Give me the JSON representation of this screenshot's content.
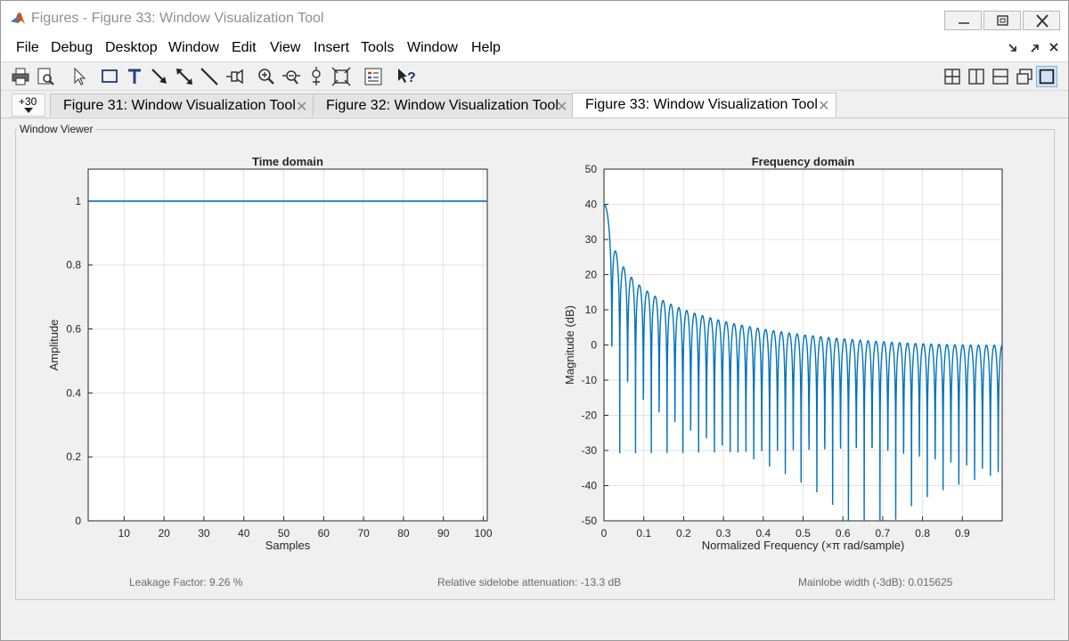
{
  "window": {
    "title": "Figures - Figure 33: Window Visualization Tool"
  },
  "menubar": {
    "items": [
      "File",
      "Debug",
      "Desktop",
      "Window",
      "Edit",
      "View",
      "Insert",
      "Tools",
      "Window",
      "Help"
    ]
  },
  "toolbar": {
    "tools": [
      "print-icon",
      "print-preview-icon",
      "pointer-icon",
      "rectangle-icon",
      "text-icon",
      "arrow-icon",
      "double-arrow-icon",
      "line-icon",
      "pin-icon",
      "zoom-in-icon",
      "zoom-out-icon",
      "pan-icon",
      "fit-icon",
      "legend-icon",
      "whats-this-icon"
    ],
    "layout": [
      "tile-icon",
      "left-right-icon",
      "top-bottom-icon",
      "float-icon",
      "maximize-icon"
    ]
  },
  "tabs": {
    "overflow_label": "+30",
    "items": [
      {
        "label": "Figure 31: Window Visualization Tool",
        "active": false
      },
      {
        "label": "Figure 32: Window Visualization Tool",
        "active": false
      },
      {
        "label": "Figure 33: Window Visualization Tool",
        "active": true
      }
    ]
  },
  "viewer": {
    "group_title": "Window Viewer"
  },
  "chart_data": [
    {
      "type": "line",
      "title": "Time domain",
      "xlabel": "Samples",
      "ylabel": "Amplitude",
      "xlim": [
        1,
        101
      ],
      "ylim": [
        0,
        1.1
      ],
      "xticks": [
        "10",
        "20",
        "30",
        "40",
        "50",
        "60",
        "70",
        "80",
        "90",
        "100"
      ],
      "yticks": [
        "0",
        "0.2",
        "0.4",
        "0.6",
        "0.8",
        "1"
      ],
      "grid": true,
      "series": [
        {
          "x": [
            1,
            101
          ],
          "y": [
            1,
            1
          ]
        }
      ],
      "color": "#0072bd"
    },
    {
      "type": "line",
      "title": "Frequency domain",
      "xlabel": "Normalized Frequency  (×π rad/sample)",
      "ylabel": "Magnitude (dB)",
      "xlim": [
        0,
        1
      ],
      "ylim": [
        -50,
        50
      ],
      "xticks": [
        "0",
        "0.1",
        "0.2",
        "0.3",
        "0.4",
        "0.5",
        "0.6",
        "0.7",
        "0.8",
        "0.9"
      ],
      "yticks": [
        "-50",
        "-40",
        "-30",
        "-20",
        "-10",
        "0",
        "10",
        "20",
        "30",
        "40",
        "50"
      ],
      "grid": true,
      "window_length": 101,
      "peak_db": 40,
      "color": "#0072bd"
    }
  ],
  "status": {
    "leakage": "Leakage Factor: 9.26 %",
    "sidelobe": "Relative sidelobe attenuation: -13.3 dB",
    "mainlobe": "Mainlobe width (-3dB): 0.015625"
  }
}
